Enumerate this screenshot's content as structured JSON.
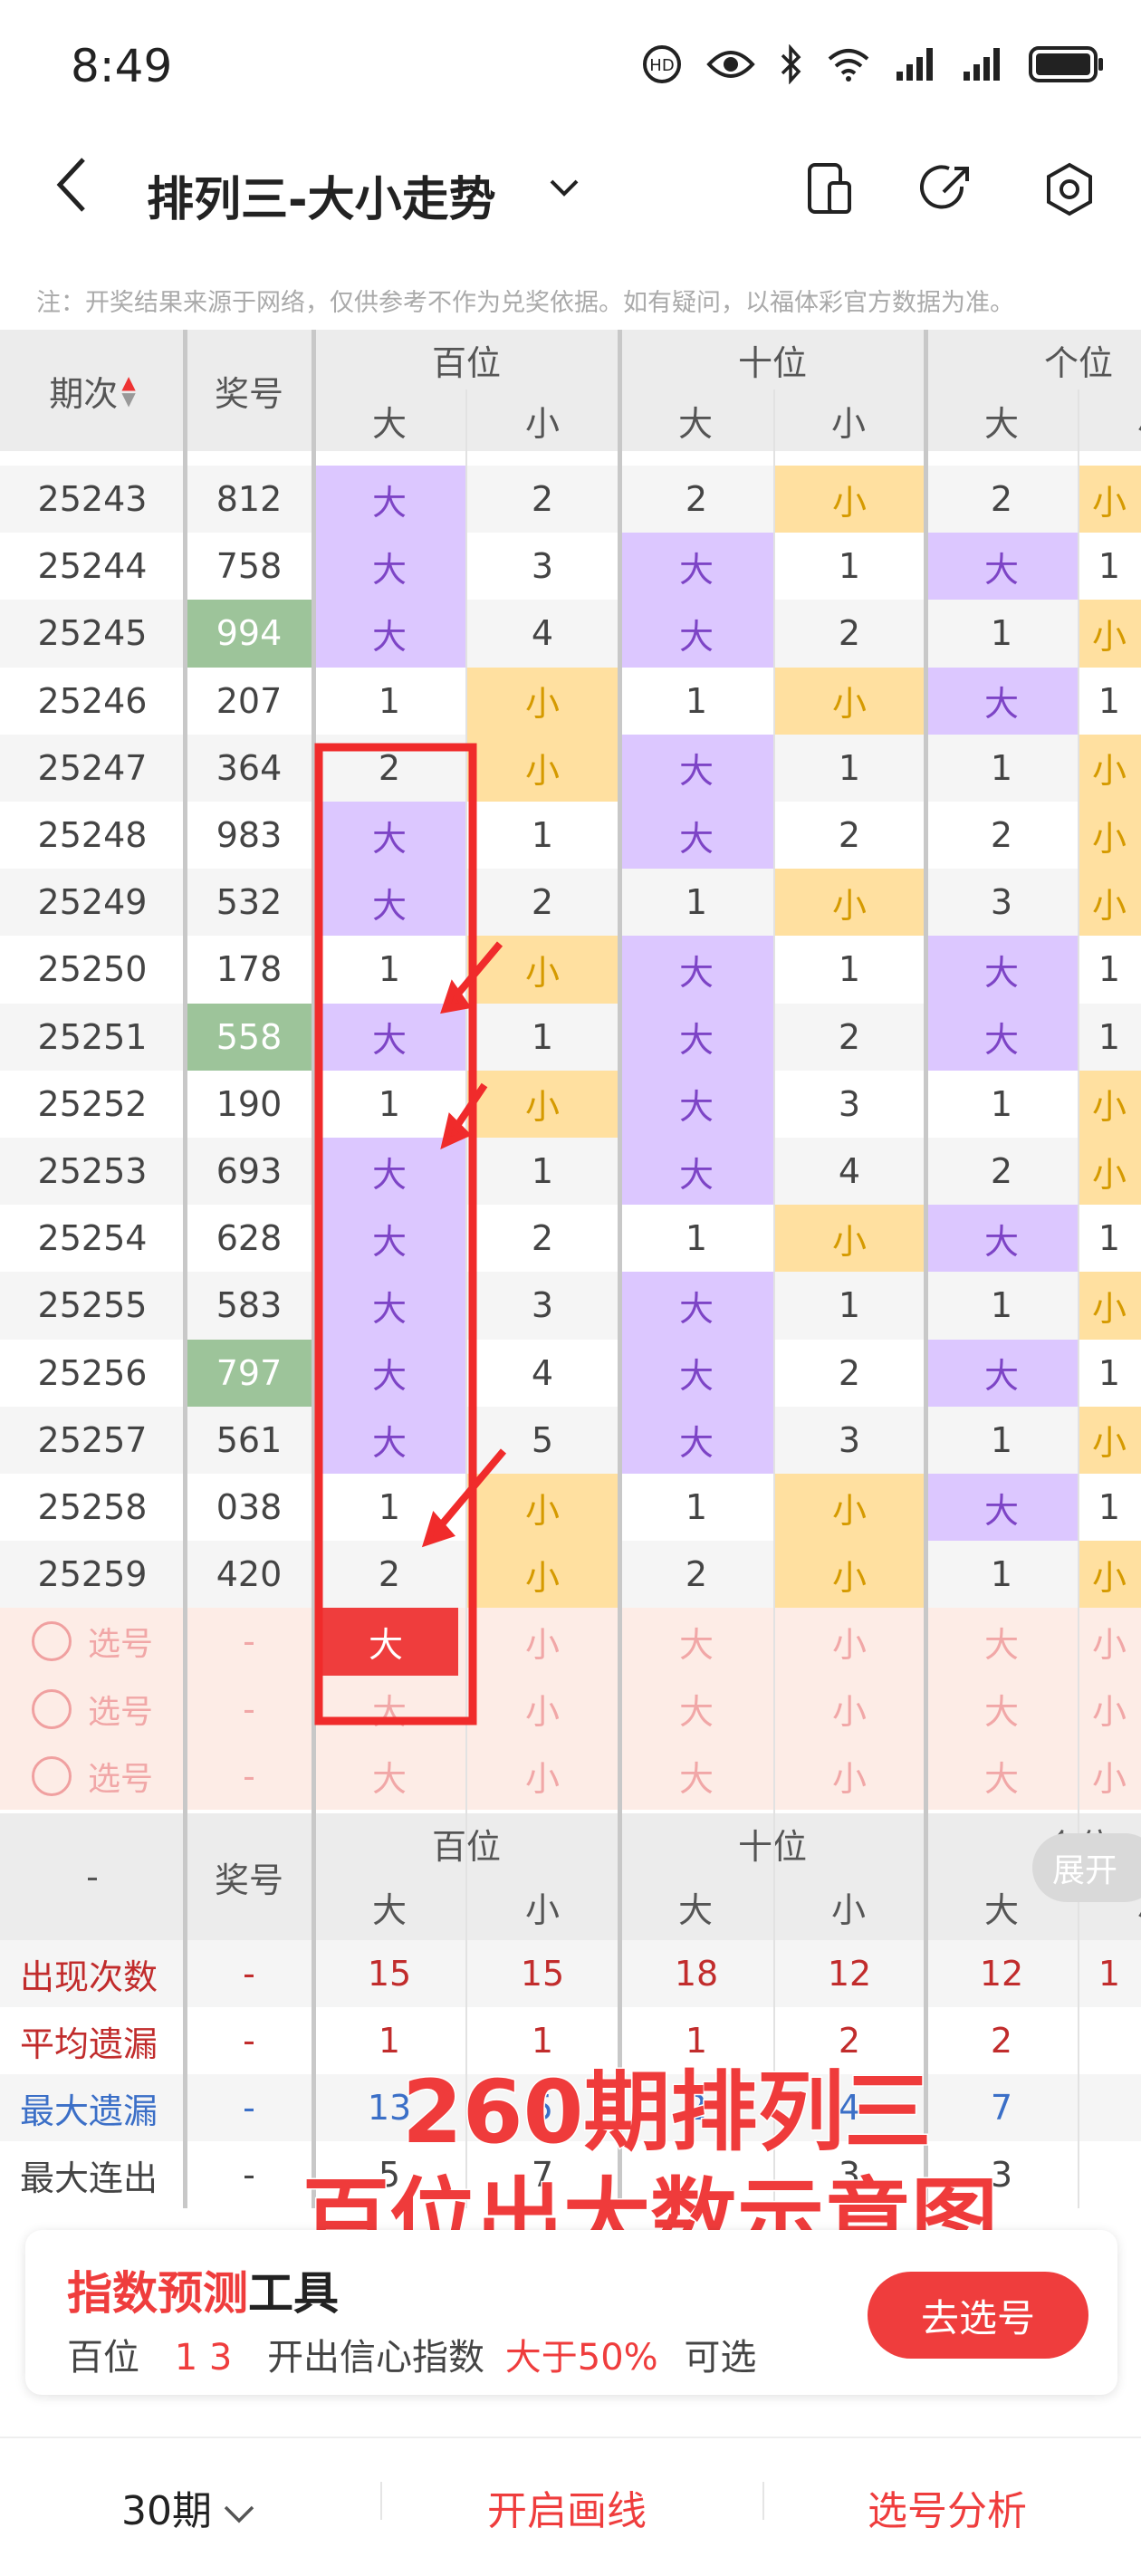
{
  "status": {
    "time": "8:49"
  },
  "header": {
    "title": "排列三-大小走势"
  },
  "note": "注：开奖结果来源于网络，仅供参考不作为兑奖依据。如有疑问，以福体彩官方数据为准。",
  "table": {
    "col_period": "期次",
    "col_number": "奖号",
    "groups": [
      "百位",
      "十位",
      "个位"
    ],
    "big": "大",
    "small": "小",
    "rows": [
      {
        "p": "25243",
        "n": "812",
        "g": false,
        "c": [
          "大",
          "2",
          "2",
          "小",
          "2",
          "小"
        ]
      },
      {
        "p": "25244",
        "n": "758",
        "g": false,
        "c": [
          "大",
          "3",
          "大",
          "1",
          "大",
          "1"
        ]
      },
      {
        "p": "25245",
        "n": "994",
        "g": true,
        "c": [
          "大",
          "4",
          "大",
          "2",
          "1",
          "小"
        ]
      },
      {
        "p": "25246",
        "n": "207",
        "g": false,
        "c": [
          "1",
          "小",
          "1",
          "小",
          "大",
          "1"
        ]
      },
      {
        "p": "25247",
        "n": "364",
        "g": false,
        "c": [
          "2",
          "小",
          "大",
          "1",
          "1",
          "小"
        ]
      },
      {
        "p": "25248",
        "n": "983",
        "g": false,
        "c": [
          "大",
          "1",
          "大",
          "2",
          "2",
          "小"
        ]
      },
      {
        "p": "25249",
        "n": "532",
        "g": false,
        "c": [
          "大",
          "2",
          "1",
          "小",
          "3",
          "小"
        ]
      },
      {
        "p": "25250",
        "n": "178",
        "g": false,
        "c": [
          "1",
          "小",
          "大",
          "1",
          "大",
          "1"
        ]
      },
      {
        "p": "25251",
        "n": "558",
        "g": true,
        "c": [
          "大",
          "1",
          "大",
          "2",
          "大",
          "1"
        ]
      },
      {
        "p": "25252",
        "n": "190",
        "g": false,
        "c": [
          "1",
          "小",
          "大",
          "3",
          "1",
          "小"
        ]
      },
      {
        "p": "25253",
        "n": "693",
        "g": false,
        "c": [
          "大",
          "1",
          "大",
          "4",
          "2",
          "小"
        ]
      },
      {
        "p": "25254",
        "n": "628",
        "g": false,
        "c": [
          "大",
          "2",
          "1",
          "小",
          "大",
          "1"
        ]
      },
      {
        "p": "25255",
        "n": "583",
        "g": false,
        "c": [
          "大",
          "3",
          "大",
          "1",
          "1",
          "小"
        ]
      },
      {
        "p": "25256",
        "n": "797",
        "g": true,
        "c": [
          "大",
          "4",
          "大",
          "2",
          "大",
          "1"
        ]
      },
      {
        "p": "25257",
        "n": "561",
        "g": false,
        "c": [
          "大",
          "5",
          "大",
          "3",
          "1",
          "小"
        ]
      },
      {
        "p": "25258",
        "n": "038",
        "g": false,
        "c": [
          "1",
          "小",
          "1",
          "小",
          "大",
          "1"
        ]
      },
      {
        "p": "25259",
        "n": "420",
        "g": false,
        "c": [
          "2",
          "小",
          "2",
          "小",
          "1",
          "小"
        ]
      }
    ],
    "pick_label": "选号",
    "pick_dash": "-"
  },
  "stats": {
    "dash": "-",
    "col_number": "奖号",
    "rows": [
      {
        "label": "出现次数",
        "dash": "-",
        "vals": [
          "15",
          "15",
          "18",
          "12",
          "12",
          "1"
        ]
      },
      {
        "label": "平均遗漏",
        "dash": "-",
        "vals": [
          "1",
          "1",
          "1",
          "2",
          "2"
        ]
      },
      {
        "label": "最大遗漏",
        "dash": "-",
        "vals": [
          "13",
          "5",
          "2",
          "4",
          "7"
        ]
      },
      {
        "label": "最大连出",
        "dash": "-",
        "vals": [
          "5",
          "7",
          "",
          "3",
          "3"
        ]
      }
    ],
    "expand": "展开"
  },
  "overlay": {
    "line1": "260期排列三",
    "line2": "百位出大数示意图"
  },
  "tool": {
    "title_red": "指数预测",
    "title_black": "工具",
    "pos": "百位",
    "digits": "1 3",
    "mid": "开出信心指数",
    "threshold": "大于50%",
    "tail": "可选",
    "button": "去选号"
  },
  "bottom": {
    "period": "30期",
    "draw": "开启画线",
    "analysis": "选号分析"
  },
  "colors": {
    "accent": "#ef3d3d",
    "purple": "#dcc7ff",
    "orange": "#ffe0a0",
    "green": "#9dc49a"
  }
}
